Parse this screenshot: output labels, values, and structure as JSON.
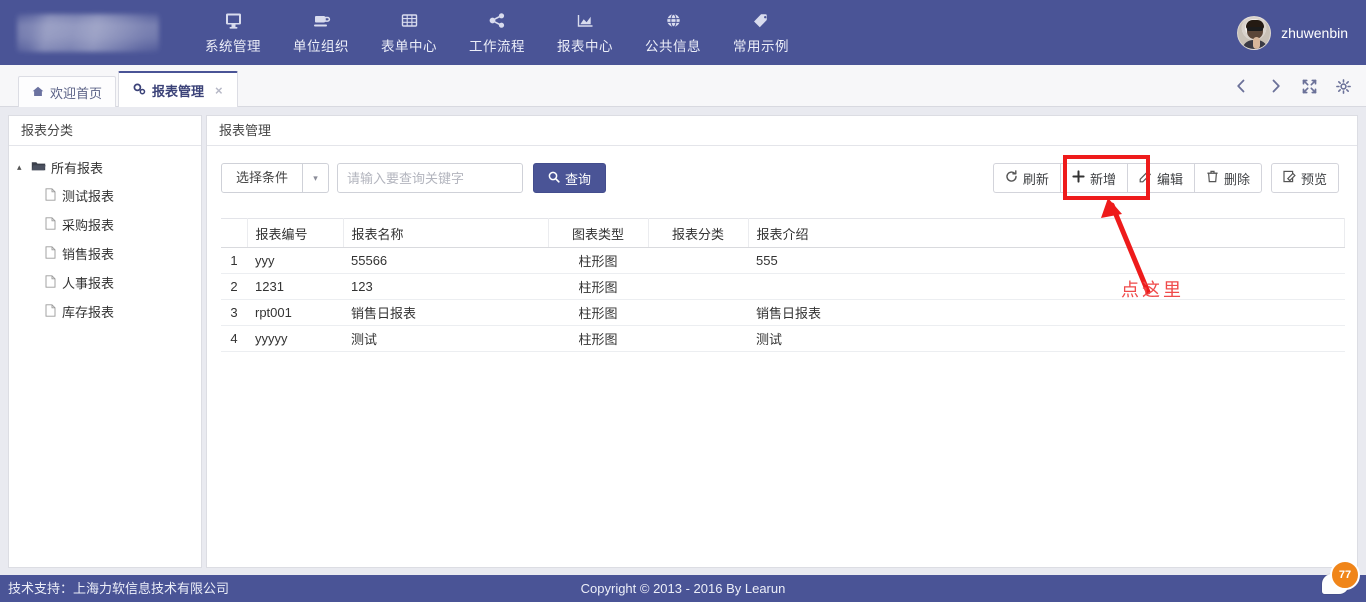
{
  "topnav": {
    "logo_alt": "redacted-logo",
    "items": [
      {
        "label": "系统管理",
        "icon": "monitor-icon"
      },
      {
        "label": "单位组织",
        "icon": "org-icon"
      },
      {
        "label": "表单中心",
        "icon": "grid-icon"
      },
      {
        "label": "工作流程",
        "icon": "share-icon"
      },
      {
        "label": "报表中心",
        "icon": "chart-icon"
      },
      {
        "label": "公共信息",
        "icon": "globe-icon"
      },
      {
        "label": "常用示例",
        "icon": "tag-icon"
      }
    ],
    "user": {
      "name": "zhuwenbin"
    }
  },
  "tabbar": {
    "tabs": [
      {
        "label": "欢迎首页",
        "icon": "home-icon",
        "active": false,
        "closable": false
      },
      {
        "label": "报表管理",
        "icon": "gears-icon",
        "active": true,
        "closable": true,
        "close_glyph": "×"
      }
    ],
    "tools": [
      {
        "name": "prev-tab-icon",
        "glyph": "‹"
      },
      {
        "name": "next-tab-icon",
        "glyph": "›"
      },
      {
        "name": "fullscreen-icon",
        "glyph": "⤢"
      },
      {
        "name": "settings-icon",
        "glyph": "⚙"
      }
    ]
  },
  "sidebar": {
    "title": "报表分类",
    "root": {
      "label": "所有报表",
      "caret": "▴",
      "icon": "folder-open-icon"
    },
    "items": [
      {
        "label": "测试报表",
        "icon": "file-icon"
      },
      {
        "label": "采购报表",
        "icon": "file-icon"
      },
      {
        "label": "销售报表",
        "icon": "file-icon"
      },
      {
        "label": "人事报表",
        "icon": "file-icon"
      },
      {
        "label": "库存报表",
        "icon": "file-icon"
      }
    ]
  },
  "content": {
    "title": "报表管理",
    "toolbar": {
      "condition_label": "选择条件",
      "condition_caret": "▾",
      "keyword_placeholder": "请输入要查询关键字",
      "keyword_value": "",
      "query_label": "查询",
      "query_icon": "search-icon",
      "buttons": [
        {
          "label": "刷新",
          "icon": "refresh-icon"
        },
        {
          "label": "新增",
          "icon": "plus-icon"
        },
        {
          "label": "编辑",
          "icon": "edit-icon"
        },
        {
          "label": "删除",
          "icon": "trash-icon"
        },
        {
          "label": "预览",
          "icon": "preview-icon"
        }
      ]
    },
    "table": {
      "columns": [
        "",
        "报表编号",
        "报表名称",
        "图表类型",
        "报表分类",
        "报表介绍"
      ],
      "rows": [
        {
          "idx": "1",
          "code": "yyy",
          "name": "55566",
          "type": "柱形图",
          "category": "",
          "desc": "555"
        },
        {
          "idx": "2",
          "code": "1231",
          "name": "123",
          "type": "柱形图",
          "category": "",
          "desc": ""
        },
        {
          "idx": "3",
          "code": "rpt001",
          "name": "销售日报表",
          "type": "柱形图",
          "category": "",
          "desc": "销售日报表"
        },
        {
          "idx": "4",
          "code": "yyyyy",
          "name": "测试",
          "type": "柱形图",
          "category": "",
          "desc": "测试"
        }
      ]
    }
  },
  "annotation": {
    "text": "点这里",
    "color": "#ef4a4a",
    "box_color": "#ee1b1b",
    "target": "新增"
  },
  "footer": {
    "left": "技术支持：上海力软信息技术有限公司",
    "center": "Copyright © 2013 - 2016 By Learun"
  },
  "chat_widget": {
    "badge_text": "77",
    "badge_color": "#f08519",
    "bubble_icon": "chat-bubble-icon"
  },
  "colors": {
    "brand": "#4a5496",
    "accent": "#4a5496",
    "annotation_red": "#ee1b1b"
  }
}
